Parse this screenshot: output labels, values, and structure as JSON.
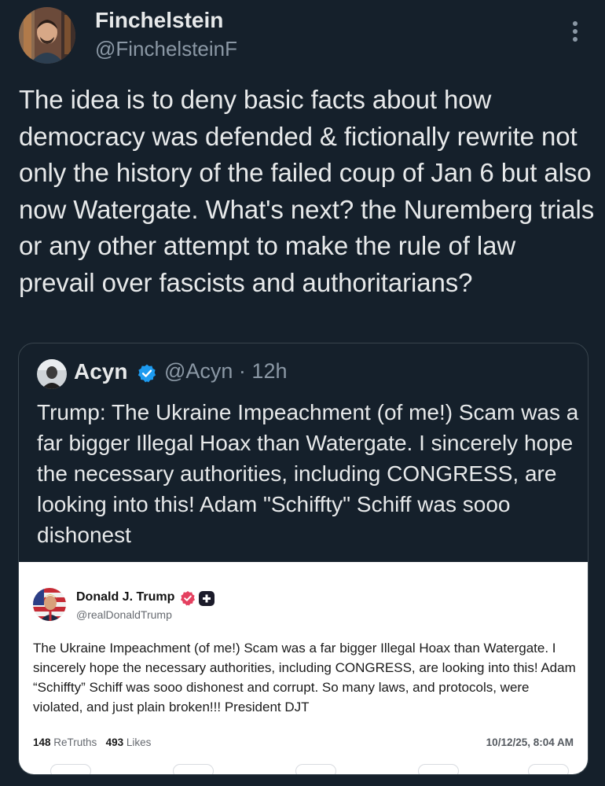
{
  "post": {
    "author_name": "Finchelstein",
    "author_handle": "@FinchelsteinF",
    "text": "The idea is to deny basic facts about how democracy was defended & fictionally rewrite not only the history of the failed coup of Jan 6 but also now Watergate. What's next? the Nuremberg trials or any other attempt to make the rule of law prevail over fascists and authoritarians?",
    "more_icon": "vertical-ellipsis-icon"
  },
  "quote": {
    "author_name": "Acyn",
    "handle_and_time": "@Acyn · 12h",
    "verified_icon": "verified-badge-icon",
    "text": "Trump: The Ukraine Impeachment (of me!) Scam was a far bigger Illegal Hoax than Watergate. I sincerely hope the necessary authorities, including CONGRESS, are looking into this! Adam \"Schiffty\" Schiff was sooo dishonest"
  },
  "truth_post": {
    "author_name": "Donald J. Trump",
    "author_handle": "@realDonaldTrump",
    "text": "The Ukraine Impeachment (of me!) Scam was a far bigger Illegal Hoax than Watergate. I sincerely hope the necessary authorities, including CONGRESS, are looking into this! Adam “Schiffty” Schiff was sooo dishonest and corrupt. So many laws, and protocols, were violated, and just plain broken!!! President DJT",
    "retruths_count": "148",
    "retruths_label": "ReTruths",
    "likes_count": "493",
    "likes_label": "Likes",
    "timestamp": "10/12/25, 8:04 AM"
  },
  "colors": {
    "background": "#15202b",
    "text_primary": "#e7e9ea",
    "text_secondary": "#8b98a5",
    "verified_blue": "#1d9bf0",
    "truth_verified_red": "#e4405f"
  }
}
